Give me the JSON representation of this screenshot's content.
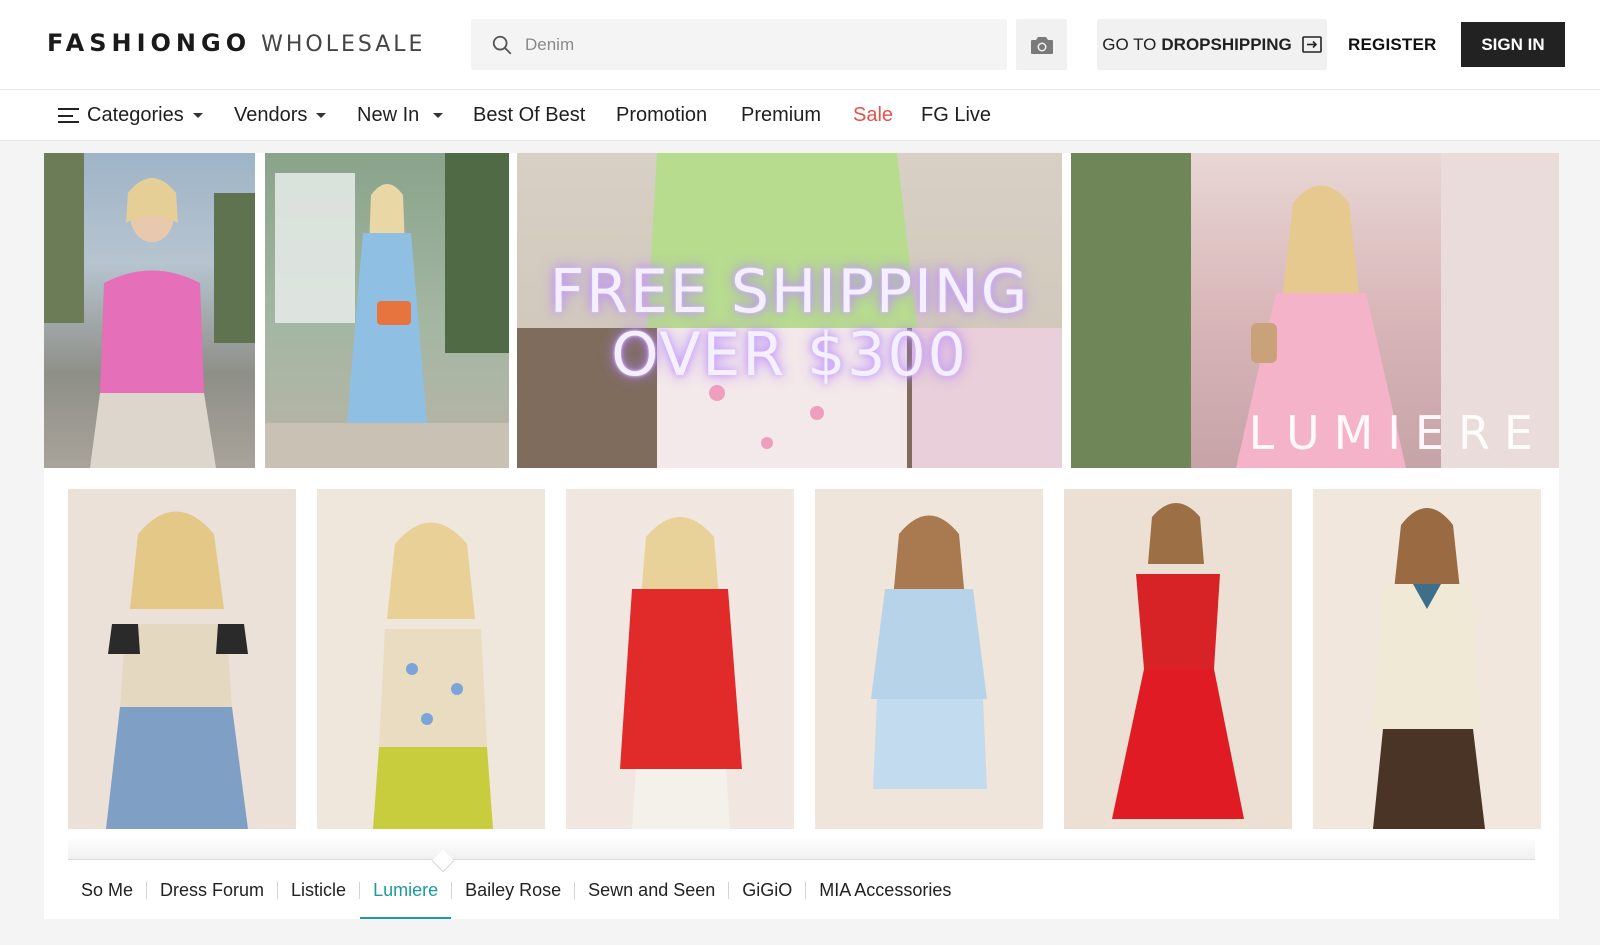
{
  "header": {
    "logo_brand": "FASHIONGO",
    "logo_sub": "WHOLESALE",
    "search_placeholder": "Denim",
    "dropship_prefix": "GO TO",
    "dropship_bold": "DROPSHIPPING",
    "register_label": "REGISTER",
    "signin_label": "SIGN IN"
  },
  "nav": {
    "items": [
      {
        "label": "Categories"
      },
      {
        "label": "Vendors"
      },
      {
        "label": "New In"
      },
      {
        "label": "Best Of Best"
      },
      {
        "label": "Promotion"
      },
      {
        "label": "Premium"
      },
      {
        "label": "Sale"
      },
      {
        "label": "FG Live"
      }
    ]
  },
  "hero": {
    "promo_line1": "FREE SHIPPING",
    "promo_line2": "OVER $300",
    "brand_watermark": "LUMIERE"
  },
  "vendor_tabs": {
    "items": [
      {
        "label": "So Me"
      },
      {
        "label": "Dress Forum"
      },
      {
        "label": "Listicle"
      },
      {
        "label": "Lumiere"
      },
      {
        "label": "Bailey Rose"
      },
      {
        "label": "Sewn and Seen"
      },
      {
        "label": "GiGiO"
      },
      {
        "label": "MIA Accessories"
      }
    ],
    "active": "Lumiere"
  },
  "colors": {
    "accent_teal": "#1c9aa0",
    "sale_red": "#e8504a",
    "signin_bg": "#222222"
  }
}
